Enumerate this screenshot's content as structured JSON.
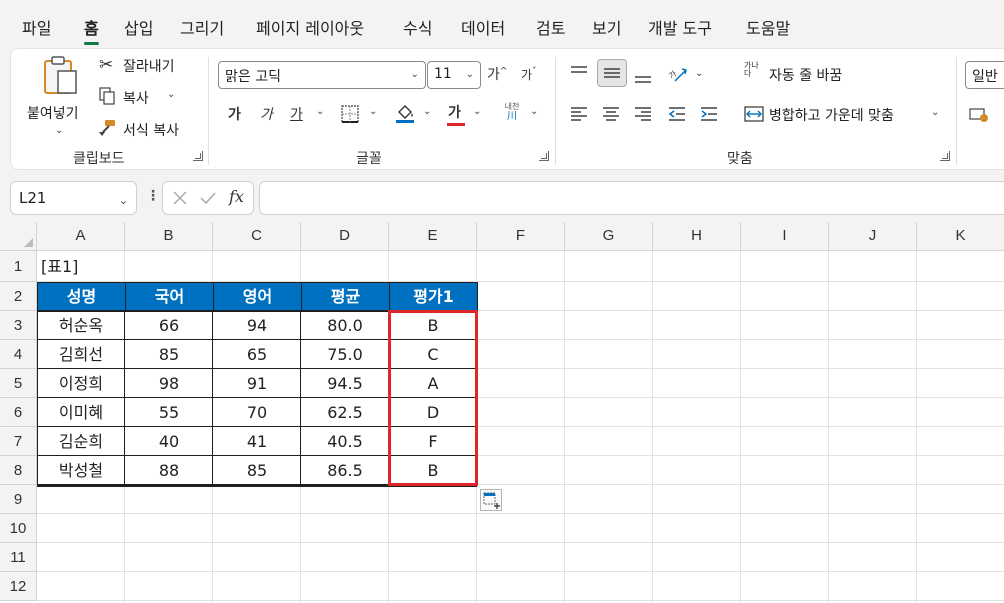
{
  "menu": {
    "tabs": [
      "파일",
      "홈",
      "삽입",
      "그리기",
      "페이지 레이아웃",
      "수식",
      "데이터",
      "검토",
      "보기",
      "개발 도구",
      "도움말"
    ],
    "active": "홈"
  },
  "ribbon": {
    "clipboard": {
      "paste": "붙여넣기",
      "cut": "잘라내기",
      "copy": "복사",
      "format_painter": "서식 복사",
      "label": "클립보드"
    },
    "font": {
      "font_name": "맑은 고딕",
      "font_size": "11",
      "bold": "가",
      "italic": "가",
      "underline": "가",
      "text_color": "가",
      "grow": "가",
      "shrink": "가",
      "phonetic_top": "내천",
      "phonetic_bottom": "川",
      "label": "글꼴"
    },
    "alignment": {
      "wrap_icon": "가나 다",
      "wrap_text": "자동 줄 바꿈",
      "merge_center": "병합하고 가운데 맞춤",
      "label": "맞춤"
    },
    "number": {
      "format": "일반"
    }
  },
  "formula_bar": {
    "name_box": "L21",
    "fx": "fx",
    "formula": ""
  },
  "sheet": {
    "columns": [
      "A",
      "B",
      "C",
      "D",
      "E",
      "F",
      "G",
      "H",
      "I",
      "J",
      "K"
    ],
    "rows": [
      "1",
      "2",
      "3",
      "4",
      "5",
      "6",
      "7",
      "8",
      "9",
      "10",
      "11",
      "12"
    ],
    "table_title": "[표1]",
    "headers": [
      "성명",
      "국어",
      "영어",
      "평균",
      "평가1"
    ],
    "data": [
      [
        "허순옥",
        "66",
        "94",
        "80.0",
        "B"
      ],
      [
        "김희선",
        "85",
        "65",
        "75.0",
        "C"
      ],
      [
        "이정희",
        "98",
        "91",
        "94.5",
        "A"
      ],
      [
        "이미혜",
        "55",
        "70",
        "62.5",
        "D"
      ],
      [
        "김순희",
        "40",
        "41",
        "40.5",
        "F"
      ],
      [
        "박성철",
        "88",
        "85",
        "86.5",
        "B"
      ]
    ]
  },
  "colors": {
    "header_fill": "#0070c0",
    "highlight_border": "#e0252b",
    "active_tab_underline": "#107c41"
  }
}
